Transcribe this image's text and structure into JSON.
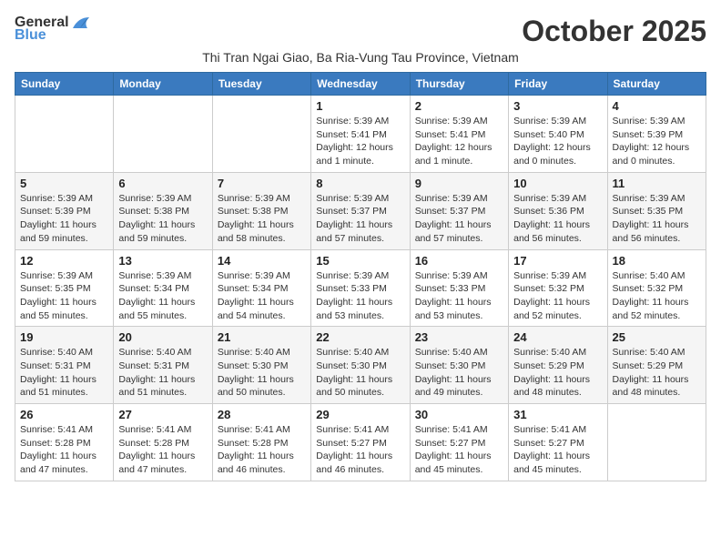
{
  "header": {
    "logo_general": "General",
    "logo_blue": "Blue",
    "month_title": "October 2025",
    "subtitle": "Thi Tran Ngai Giao, Ba Ria-Vung Tau Province, Vietnam"
  },
  "days_of_week": [
    "Sunday",
    "Monday",
    "Tuesday",
    "Wednesday",
    "Thursday",
    "Friday",
    "Saturday"
  ],
  "weeks": [
    [
      {
        "day": "",
        "info": ""
      },
      {
        "day": "",
        "info": ""
      },
      {
        "day": "",
        "info": ""
      },
      {
        "day": "1",
        "info": "Sunrise: 5:39 AM\nSunset: 5:41 PM\nDaylight: 12 hours\nand 1 minute."
      },
      {
        "day": "2",
        "info": "Sunrise: 5:39 AM\nSunset: 5:41 PM\nDaylight: 12 hours\nand 1 minute."
      },
      {
        "day": "3",
        "info": "Sunrise: 5:39 AM\nSunset: 5:40 PM\nDaylight: 12 hours\nand 0 minutes."
      },
      {
        "day": "4",
        "info": "Sunrise: 5:39 AM\nSunset: 5:39 PM\nDaylight: 12 hours\nand 0 minutes."
      }
    ],
    [
      {
        "day": "5",
        "info": "Sunrise: 5:39 AM\nSunset: 5:39 PM\nDaylight: 11 hours\nand 59 minutes."
      },
      {
        "day": "6",
        "info": "Sunrise: 5:39 AM\nSunset: 5:38 PM\nDaylight: 11 hours\nand 59 minutes."
      },
      {
        "day": "7",
        "info": "Sunrise: 5:39 AM\nSunset: 5:38 PM\nDaylight: 11 hours\nand 58 minutes."
      },
      {
        "day": "8",
        "info": "Sunrise: 5:39 AM\nSunset: 5:37 PM\nDaylight: 11 hours\nand 57 minutes."
      },
      {
        "day": "9",
        "info": "Sunrise: 5:39 AM\nSunset: 5:37 PM\nDaylight: 11 hours\nand 57 minutes."
      },
      {
        "day": "10",
        "info": "Sunrise: 5:39 AM\nSunset: 5:36 PM\nDaylight: 11 hours\nand 56 minutes."
      },
      {
        "day": "11",
        "info": "Sunrise: 5:39 AM\nSunset: 5:35 PM\nDaylight: 11 hours\nand 56 minutes."
      }
    ],
    [
      {
        "day": "12",
        "info": "Sunrise: 5:39 AM\nSunset: 5:35 PM\nDaylight: 11 hours\nand 55 minutes."
      },
      {
        "day": "13",
        "info": "Sunrise: 5:39 AM\nSunset: 5:34 PM\nDaylight: 11 hours\nand 55 minutes."
      },
      {
        "day": "14",
        "info": "Sunrise: 5:39 AM\nSunset: 5:34 PM\nDaylight: 11 hours\nand 54 minutes."
      },
      {
        "day": "15",
        "info": "Sunrise: 5:39 AM\nSunset: 5:33 PM\nDaylight: 11 hours\nand 53 minutes."
      },
      {
        "day": "16",
        "info": "Sunrise: 5:39 AM\nSunset: 5:33 PM\nDaylight: 11 hours\nand 53 minutes."
      },
      {
        "day": "17",
        "info": "Sunrise: 5:39 AM\nSunset: 5:32 PM\nDaylight: 11 hours\nand 52 minutes."
      },
      {
        "day": "18",
        "info": "Sunrise: 5:40 AM\nSunset: 5:32 PM\nDaylight: 11 hours\nand 52 minutes."
      }
    ],
    [
      {
        "day": "19",
        "info": "Sunrise: 5:40 AM\nSunset: 5:31 PM\nDaylight: 11 hours\nand 51 minutes."
      },
      {
        "day": "20",
        "info": "Sunrise: 5:40 AM\nSunset: 5:31 PM\nDaylight: 11 hours\nand 51 minutes."
      },
      {
        "day": "21",
        "info": "Sunrise: 5:40 AM\nSunset: 5:30 PM\nDaylight: 11 hours\nand 50 minutes."
      },
      {
        "day": "22",
        "info": "Sunrise: 5:40 AM\nSunset: 5:30 PM\nDaylight: 11 hours\nand 50 minutes."
      },
      {
        "day": "23",
        "info": "Sunrise: 5:40 AM\nSunset: 5:30 PM\nDaylight: 11 hours\nand 49 minutes."
      },
      {
        "day": "24",
        "info": "Sunrise: 5:40 AM\nSunset: 5:29 PM\nDaylight: 11 hours\nand 48 minutes."
      },
      {
        "day": "25",
        "info": "Sunrise: 5:40 AM\nSunset: 5:29 PM\nDaylight: 11 hours\nand 48 minutes."
      }
    ],
    [
      {
        "day": "26",
        "info": "Sunrise: 5:41 AM\nSunset: 5:28 PM\nDaylight: 11 hours\nand 47 minutes."
      },
      {
        "day": "27",
        "info": "Sunrise: 5:41 AM\nSunset: 5:28 PM\nDaylight: 11 hours\nand 47 minutes."
      },
      {
        "day": "28",
        "info": "Sunrise: 5:41 AM\nSunset: 5:28 PM\nDaylight: 11 hours\nand 46 minutes."
      },
      {
        "day": "29",
        "info": "Sunrise: 5:41 AM\nSunset: 5:27 PM\nDaylight: 11 hours\nand 46 minutes."
      },
      {
        "day": "30",
        "info": "Sunrise: 5:41 AM\nSunset: 5:27 PM\nDaylight: 11 hours\nand 45 minutes."
      },
      {
        "day": "31",
        "info": "Sunrise: 5:41 AM\nSunset: 5:27 PM\nDaylight: 11 hours\nand 45 minutes."
      },
      {
        "day": "",
        "info": ""
      }
    ]
  ]
}
